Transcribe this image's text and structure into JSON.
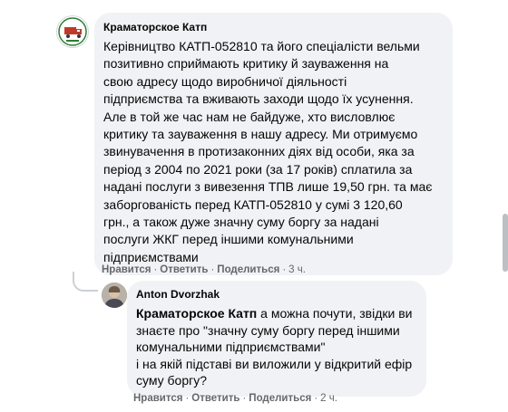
{
  "comment": {
    "author": "Краматорское Катп",
    "lines": [
      "Керівництво КАТП-052810 та його спеціалісти вельми",
      "позитивно сприймають критику й зауваження на",
      "свою адресу щодо виробничої діяльності",
      "підприємства та вживають заходи щодо їх усунення.",
      "Але в той же час нам не байдуже, хто висловлює",
      "критику та зауваження в нашу адресу. Ми отримуємо",
      "звинувачення в протизаконних діях від особи, яка за",
      "період з 2004 по 2021 роки (за 17 років) сплатила за",
      "надані послуги з вивезення ТПВ лише 19,50 грн. та має",
      "заборгованість перед КАТП-052810 у сумі 3 120,60",
      "грн., а також дуже значну суму боргу за надані",
      "послуги ЖКГ перед іншими комунальними",
      "підприємствами"
    ],
    "actions": {
      "like": "Нравится",
      "reply": "Ответить",
      "share": "Поделиться",
      "separator": "·",
      "time": "3 ч."
    }
  },
  "reply": {
    "author": "Anton Dvorzhak",
    "mention": "Краматорское Катп",
    "lines": [
      " а можна почути, звідки ви",
      "знаєте про \"значну суму боргу перед іншими",
      "комунальними підприємствами\"",
      "і на якій підставі ви виложили у відкритий ефір",
      "суму боргу?"
    ],
    "actions": {
      "like": "Нравится",
      "reply": "Ответить",
      "share": "Поделиться",
      "separator": "·",
      "time": "2 ч."
    }
  },
  "colors": {
    "bubble": "#f0f2f5",
    "meta_text": "#65676b",
    "logo_red": "#c0392b",
    "logo_green": "#2e7d32"
  },
  "icons": {
    "page_avatar": "katp-logo-icon",
    "user_avatar": "user-photo-avatar"
  }
}
